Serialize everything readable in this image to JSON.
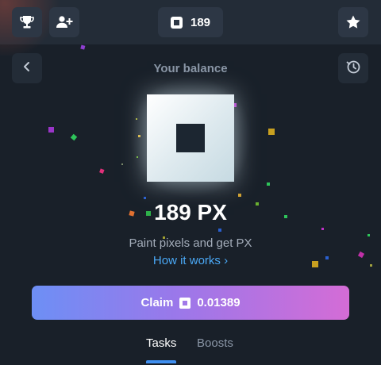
{
  "header": {
    "trophy_icon": "trophy-icon",
    "add_friend_icon": "add-user-icon",
    "balance_pill_value": "189",
    "favorites_icon": "star-icon"
  },
  "balance_screen": {
    "title": "Your balance",
    "back_icon": "chevron-left-icon",
    "history_icon": "clock-history-icon",
    "balance_amount": "189 PX",
    "subtitle": "Paint pixels and get PX",
    "how_it_works_link": "How it works ›",
    "claim_label": "Claim",
    "claim_amount": "0.01389"
  },
  "tabs": [
    {
      "label": "Tasks",
      "active": true
    },
    {
      "label": "Boosts",
      "active": false
    }
  ],
  "colors": {
    "background": "#192029",
    "topbar": "#232c37",
    "button": "#2d3745",
    "link": "#4aa8f5",
    "claim_gradient_start": "#6d8ff5",
    "claim_gradient_end": "#d46cd6",
    "tab_active_underline": "#3f8ff0"
  }
}
